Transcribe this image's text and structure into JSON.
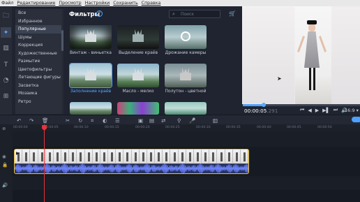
{
  "menu": {
    "items": [
      "Файл",
      "Редактирование",
      "Просмотр",
      "Настройки",
      "Сохранить",
      "Справка"
    ]
  },
  "categories": {
    "items": [
      "Все",
      "Избранное",
      "Популярные",
      "Шумы",
      "Коррекция",
      "Художественные",
      "Размытие",
      "Цветофильтры",
      "Летающие фигуры",
      "Засветка",
      "Мозаика",
      "Ретро"
    ],
    "selected": "Популярные"
  },
  "filters": {
    "title": "Фильтры",
    "help_icon": "?",
    "search_placeholder": "Поиск",
    "items": [
      {
        "label": "Винтаж - виньетка",
        "icon": "vignette"
      },
      {
        "label": "Выделение краёв",
        "icon": "edges"
      },
      {
        "label": "Дрожание камеры",
        "icon": "camera-shake"
      },
      {
        "label": "Заполнение краёв",
        "icon": "fill-edges",
        "selected": true
      },
      {
        "label": "Масло - мелко",
        "icon": "oil"
      },
      {
        "label": "Полутон - цветной",
        "icon": "halftone"
      }
    ]
  },
  "player": {
    "timecode_main": "00:00:05",
    "timecode_ms": ".291",
    "progress_fraction": 0.18,
    "aspect_ratio": "16:9"
  },
  "timeline": {
    "ruler_ticks": [
      "00:00:00",
      "00:00:05",
      "00:00:10",
      "00:00:15",
      "00:00:20",
      "00:00:25",
      "00:00:30",
      "00:00:35",
      "00:00:40",
      "00:00:45",
      "00:00:50"
    ]
  },
  "colors": {
    "accent": "#4ea1ff",
    "clip_border": "#f1c232",
    "playhead": "#e2343a",
    "audio_wave": "#6f86ff"
  }
}
